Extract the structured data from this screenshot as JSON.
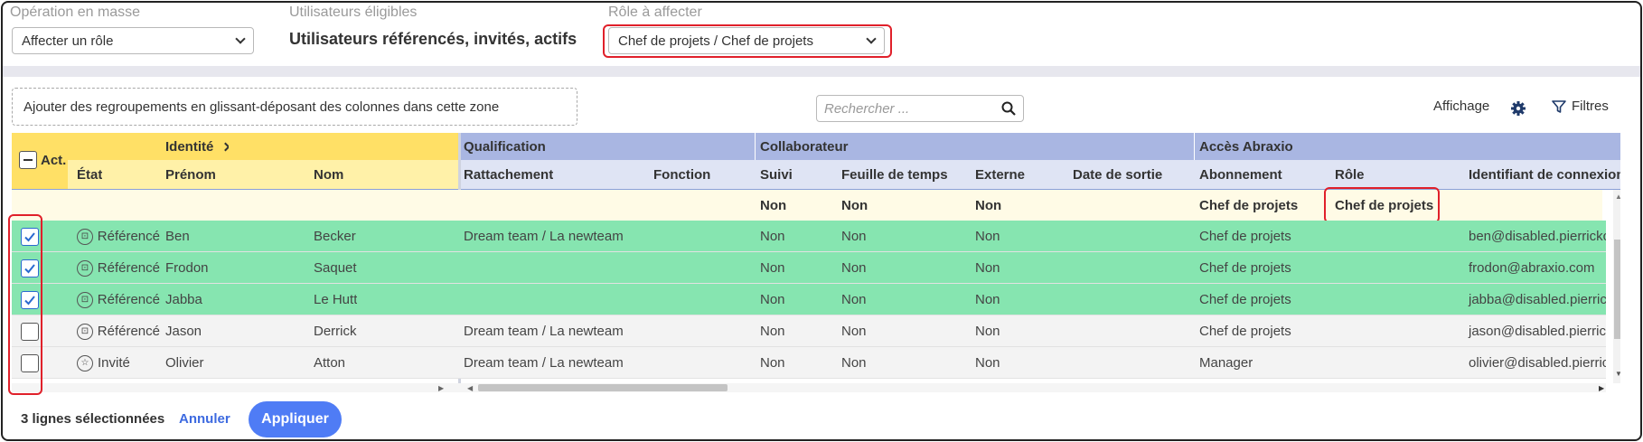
{
  "top": {
    "bulk_label": "Opération en masse",
    "bulk_value": "Affecter un rôle",
    "eligible_label": "Utilisateurs éligibles",
    "eligible_value": "Utilisateurs référencés, invités, actifs",
    "role_label": "Rôle à affecter",
    "role_value": "Chef de projets / Chef de projets"
  },
  "toolbar": {
    "group_zone": "Ajouter des regroupements en glissant-déposant des colonnes dans cette zone",
    "search_placeholder": "Rechercher ...",
    "display_label": "Affichage",
    "filters_label": "Filtres"
  },
  "grid": {
    "group_headers": {
      "act": "Act.",
      "identite": "Identité",
      "qualification": "Qualification",
      "collaborateur": "Collaborateur",
      "acces": "Accès Abraxio"
    },
    "columns": {
      "etat": "État",
      "prenom": "Prénom",
      "nom": "Nom",
      "rattachement": "Rattachement",
      "fonction": "Fonction",
      "suivi": "Suivi",
      "feuille": "Feuille de temps",
      "externe": "Externe",
      "sortie": "Date de sortie",
      "abonnement": "Abonnement",
      "role": "Rôle",
      "identifiant": "Identifiant de connexion"
    },
    "preview_row": {
      "suivi": "Non",
      "feuille": "Non",
      "externe": "Non",
      "abonnement": "Chef de projets",
      "role": "Chef de projets"
    },
    "rows": [
      {
        "checked": true,
        "etat": "Référencé",
        "prenom": "Ben",
        "nom": "Becker",
        "rattachement": "Dream team / La newteam",
        "suivi": "Non",
        "feuille": "Non",
        "externe": "Non",
        "abonnement": "Chef de projets",
        "identifiant": "ben@disabled.pierrickc"
      },
      {
        "checked": true,
        "etat": "Référencé",
        "prenom": "Frodon",
        "nom": "Saquet",
        "rattachement": "",
        "suivi": "Non",
        "feuille": "Non",
        "externe": "Non",
        "abonnement": "Chef de projets",
        "identifiant": "frodon@abraxio.com"
      },
      {
        "checked": true,
        "etat": "Référencé",
        "prenom": "Jabba",
        "nom": "Le Hutt",
        "rattachement": "",
        "suivi": "Non",
        "feuille": "Non",
        "externe": "Non",
        "abonnement": "Chef de projets",
        "identifiant": "jabba@disabled.pierrick"
      },
      {
        "checked": false,
        "etat": "Référencé",
        "prenom": "Jason",
        "nom": "Derrick",
        "rattachement": "Dream team / La newteam",
        "suivi": "Non",
        "feuille": "Non",
        "externe": "Non",
        "abonnement": "Chef de projets",
        "identifiant": "jason@disabled.pierrick"
      },
      {
        "checked": false,
        "etat": "Invité",
        "prenom": "Olivier",
        "nom": "Atton",
        "rattachement": "Dream team / La newteam",
        "suivi": "Non",
        "feuille": "Non",
        "externe": "Non",
        "abonnement": "Manager",
        "identifiant": "olivier@disabled.pierric"
      }
    ]
  },
  "footer": {
    "selected_count": "3 lignes sélectionnées",
    "cancel_label": "Annuler",
    "apply_label": "Appliquer"
  },
  "colors": {
    "accent": "#4f7cf5",
    "selected_row": "#86e5b0",
    "identity_header": "#ffe066",
    "qualif_header": "#a9b6e2",
    "highlight": "#e0202a"
  },
  "icons": [
    "chevron-down-icon",
    "search-icon",
    "gear-icon",
    "filter-icon",
    "checkbox-icon",
    "referenced-badge-icon",
    "invited-star-icon",
    "chevron-right-icon"
  ]
}
